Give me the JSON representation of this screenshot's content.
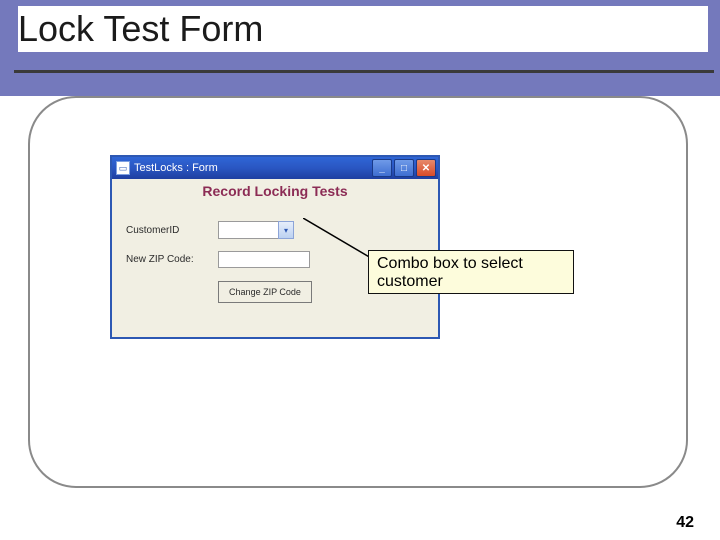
{
  "slide": {
    "title": "Lock Test Form",
    "page_number": "42"
  },
  "window": {
    "title": "TestLocks : Form",
    "heading": "Record Locking Tests",
    "labels": {
      "customer_id": "CustomerID",
      "new_zip": "New ZIP Code:"
    },
    "combo": {
      "value": ""
    },
    "zip_input_value": "",
    "button_label": "Change ZIP Code"
  },
  "annotation": {
    "text": "Combo box to select customer"
  }
}
